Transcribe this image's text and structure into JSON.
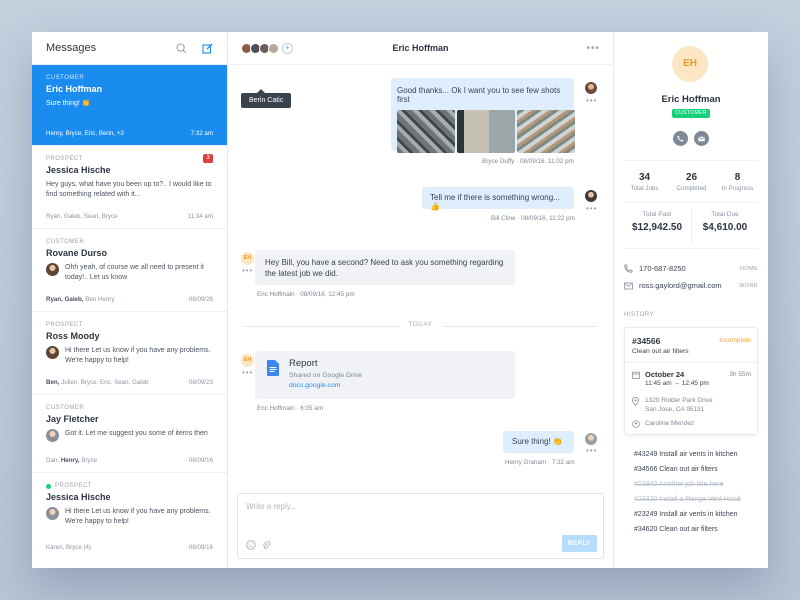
{
  "conversations": {
    "title": "Messages",
    "items": [
      {
        "tag": "CUSTOMER",
        "name": "Eric Hoffman",
        "msg": "Sure thing! 👏",
        "people": "Henry, Bryce, Eric, Berin, +3",
        "time": "7:32 am"
      },
      {
        "tag": "PROSPECT",
        "name": "Jessica Hische",
        "msg": "Hey guys, what have you been up to?.. I would like to find something related with it...",
        "people": "Ryan, Galeb, Sean, Bryce",
        "time": "11:34 am",
        "badge": "3"
      },
      {
        "tag": "CUSTOMER",
        "name": "Rovane Durso",
        "msg": "Ohh yeah, of course we all need to present it today!.. Let us know",
        "people_bold": "Ryan, Galeb,",
        "people_rest": " Ben Henry",
        "time": "08/09/26"
      },
      {
        "tag": "PROSPECT",
        "name": "Ross Moody",
        "msg": "Hi there Let us know if you have any problems. We're happy to help!",
        "people_bold": "Ben,",
        "people_rest": " Julien, Bryce, Eric, Sean, Galeb",
        "time": "08/09/23"
      },
      {
        "tag": "CUSTOMER",
        "name": "Jay Fletcher",
        "msg": "Got it. Let me suggest you some of items then",
        "people": "Dan,",
        "people_bold": "Henry,",
        "people_rest": " Bryce",
        "time": "08/09/16"
      },
      {
        "tag": "PROSPECT",
        "name": "Jessica Hische",
        "msg": "Hi there Let us know if you have any problems. We're happy to help!",
        "people": "Karen, Bryce (4)",
        "time": "08/09/16"
      }
    ]
  },
  "chat": {
    "title": "Eric Hoffman",
    "tooltip": "Berin Catic",
    "messages": [
      {
        "text": "Good thanks... Ok I want you to see few shots first",
        "author": "Bryce Duffy",
        "when": "08/09/16, 11:02 pm"
      },
      {
        "text": "Tell me if there is something wrong... 👍",
        "author": "Bill Cline",
        "when": "08/09/16, 11:22 pm"
      },
      {
        "text": "Hey Bill, you have a second? Need to ask you something regarding the latest job we did.",
        "author": "Eric Hoffmain",
        "when": "08/09/16, 12:45 pm"
      },
      {
        "author": "Eric Hoffmain",
        "when": "6:05 am"
      },
      {
        "text": "Sure thing! 👏",
        "author": "Henry Graham",
        "when": "7:32 am"
      }
    ],
    "divider": "TODAY",
    "attachment": {
      "title": "Report",
      "subtitle": "Shared on Google Drive",
      "link": "docs.google.com"
    },
    "eh": "EH",
    "reply": {
      "placeholder": "Write a reply...",
      "button": "REPLY"
    }
  },
  "profile": {
    "initials": "EH",
    "name": "Eric Hoffman",
    "tag": "CUSTOMER",
    "stats": [
      {
        "n": "34",
        "l": "Total Jobs"
      },
      {
        "n": "26",
        "l": "Completed"
      },
      {
        "n": "8",
        "l": "In Progress"
      }
    ],
    "paid": {
      "l": "Total Paid",
      "n": "$12,942.50"
    },
    "due": {
      "l": "Total Due",
      "n": "$4,610.00"
    },
    "phone": {
      "v": "170-687-8250",
      "k": "HOME"
    },
    "email": {
      "v": "ross.gaylord@gmail.com",
      "k": "WORK"
    },
    "history_label": "HISTORY",
    "job": {
      "id": "#34566",
      "status": "Incomplete",
      "desc": "Clean out air filters",
      "date": "October 24",
      "time": "11:45 am",
      "arrow": "→",
      "end": "12:45 pm",
      "duration": "3h 55m",
      "addr1": "1320 Ridder Park Drive",
      "addr2": "San Jose, CA 95131",
      "tech": "Caroline Mendez"
    },
    "history": [
      {
        "t": "#43249  Install air vents in kitchen",
        "s": false
      },
      {
        "t": "#34566  Clean out air filters",
        "s": false
      },
      {
        "t": "#03842  Another job title here",
        "s": true
      },
      {
        "t": "#23320  Install a Range Vent Hood",
        "s": true
      },
      {
        "t": "#23249  Install air vents in kitchen",
        "s": false
      },
      {
        "t": "#34620  Clean out air filters",
        "s": false
      }
    ]
  },
  "colors": {
    "accent": "#1a8cf0",
    "badge": "#e0403d",
    "green": "#18d07a",
    "incomplete": "#f0a33a"
  }
}
